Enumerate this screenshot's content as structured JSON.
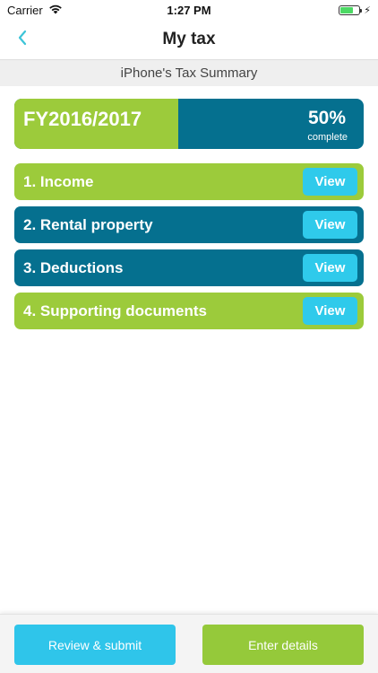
{
  "status": {
    "carrier": "Carrier",
    "time": "1:27 PM"
  },
  "nav": {
    "title": "My tax"
  },
  "summary": {
    "title": "iPhone's Tax Summary"
  },
  "fy": {
    "label": "FY2016/2017",
    "percent_text": "50%",
    "complete_text": "complete",
    "progress_fraction": 0.47
  },
  "sections": [
    {
      "label": "1. Income",
      "view_label": "View",
      "style": "green"
    },
    {
      "label": "2. Rental property",
      "view_label": "View",
      "style": "teal"
    },
    {
      "label": "3. Deductions",
      "view_label": "View",
      "style": "teal"
    },
    {
      "label": "4. Supporting documents",
      "view_label": "View",
      "style": "green"
    }
  ],
  "bottom": {
    "review_label": "Review & submit",
    "enter_label": "Enter details"
  },
  "colors": {
    "green": "#9ccb3b",
    "teal": "#05708f",
    "cyan": "#2fcaeb",
    "back_chevron": "#3cc4d8"
  }
}
